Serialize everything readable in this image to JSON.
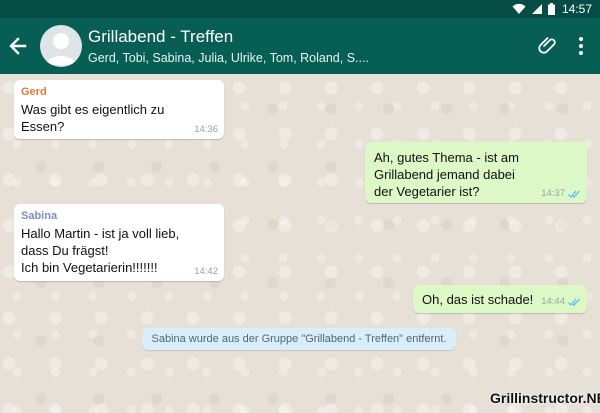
{
  "status_bar": {
    "time": "14:57",
    "icons": [
      "wifi-icon",
      "signal-icon",
      "battery-icon"
    ]
  },
  "header": {
    "title": "Grillabend - Treffen",
    "members": "Gerd, Tobi, Sabina, Julia, Ulrike, Tom, Roland, S....",
    "icons": [
      "back-arrow-icon",
      "avatar-icon",
      "paperclip-icon",
      "more-vert-icon"
    ]
  },
  "messages": [
    {
      "direction": "incoming",
      "sender": "Gerd",
      "sender_color": "#e07b39",
      "text": "Was gibt es eigentlich zu\nEssen?",
      "time": "14:36"
    },
    {
      "direction": "outgoing",
      "text": "Ah, gutes Thema - ist am\nGrillabend jemand dabei\nder Vegetarier ist?",
      "time": "14:37",
      "status": "read"
    },
    {
      "direction": "incoming",
      "sender": "Sabina",
      "sender_color": "#7b8ec8",
      "text": "Hallo Martin - ist ja voll lieb,\ndass Du frägst!\nIch bin Vegetarierin!!!!!!!",
      "time": "14:42"
    },
    {
      "direction": "outgoing",
      "text": "Oh, das ist schade!",
      "time": "14:44",
      "status": "read"
    }
  ],
  "system_message": "Sabina wurde aus der Gruppe \"Grillabend - Treffen\" entfernt.",
  "watermark": "Grillinstructor.NET",
  "colors": {
    "header": "#075e54",
    "status_bar": "#054d44",
    "outgoing_bubble": "#dcf8c6",
    "incoming_bubble": "#ffffff",
    "read_ticks": "#4fc3f7"
  }
}
